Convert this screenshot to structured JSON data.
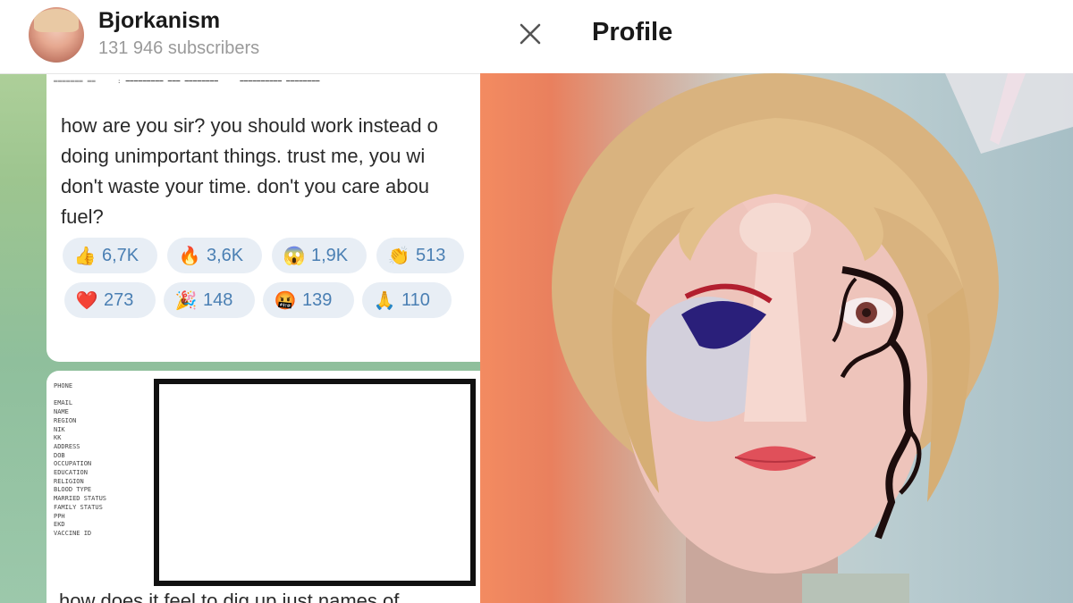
{
  "channel": {
    "name": "Bjorkanism",
    "subscribers": "131 946 subscribers"
  },
  "message1": {
    "text": "how are you sir? you should work instead o\ndoing unimportant things. trust me, you wi\ndon't waste your time. don't you care abou\nfuel?",
    "reactions_row1": [
      {
        "emoji": "👍",
        "count": "6,7K"
      },
      {
        "emoji": "🔥",
        "count": "3,6K"
      },
      {
        "emoji": "😱",
        "count": "1,9K"
      },
      {
        "emoji": "👏",
        "count": "513"
      }
    ],
    "reactions_row2": [
      {
        "emoji": "❤️",
        "count": "273"
      },
      {
        "emoji": "🎉",
        "count": "148"
      },
      {
        "emoji": "🤬",
        "count": "139"
      },
      {
        "emoji": "🙏",
        "count": "110"
      }
    ]
  },
  "message2": {
    "fields": [
      "PHONE",
      "",
      "EMAIL",
      "NAME",
      "REGION",
      "NIK",
      "KK",
      "ADDRESS",
      "DOB",
      "OCCUPATION",
      "EDUCATION",
      "RELIGION",
      "BLOOD TYPE",
      "MARRIED STATUS",
      "FAMILY STATUS",
      "PPH",
      "EKD",
      "VACCINE ID"
    ],
    "bottom_text": "how does it feel to dig up just names of"
  },
  "profile": {
    "title": "Profile",
    "close_icon": "close-icon"
  }
}
